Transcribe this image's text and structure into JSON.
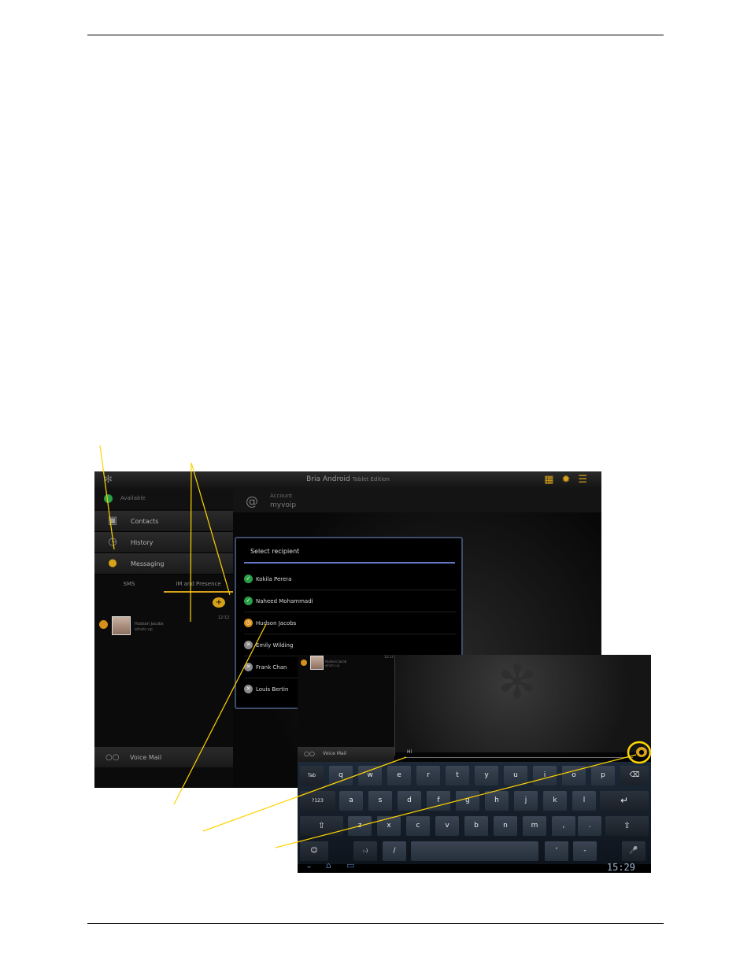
{
  "page": {
    "highlight_color": "#ffd400",
    "line_color": "#000000"
  },
  "screenshot1": {
    "title": "Bria Android",
    "title_edition": "Tablet Edition",
    "top_icons": [
      "dialpad-icon",
      "gear-icon",
      "menu-icon"
    ],
    "status": {
      "label": "Available",
      "color": "#2aa148"
    },
    "nav": {
      "contacts": "Contacts",
      "history": "History",
      "messaging": "Messaging"
    },
    "tabs": {
      "sms": "SMS",
      "im": "IM and Presence"
    },
    "conversation": {
      "name": "Hudson Jacobs",
      "message": "whats up",
      "time": "12:12"
    },
    "voicemail": "Voice Mail",
    "account": {
      "caption": "Account",
      "value": "myvoip"
    },
    "dialog": {
      "title": "Select recipient",
      "recipients": [
        {
          "name": "Kokila Perera",
          "status": "available"
        },
        {
          "name": "Naheed Mohammadi",
          "status": "available"
        },
        {
          "name": "Hudson Jacobs",
          "status": "away"
        },
        {
          "name": "Emily Wilding",
          "status": "offline"
        },
        {
          "name": "Frank Chan",
          "status": "offline"
        },
        {
          "name": "Louis Bertin",
          "status": "offline"
        }
      ]
    }
  },
  "screenshot2": {
    "conversation": {
      "name": "Hudson Jacob",
      "message": "whats up",
      "time": "12:13"
    },
    "voicemail": "Voice Mail",
    "input_value": "Hi",
    "clock": "15:29",
    "keys": {
      "row1": [
        "Tab",
        "q",
        "w",
        "e",
        "r",
        "t",
        "y",
        "u",
        "i",
        "o",
        "p",
        "⌫"
      ],
      "row2": [
        "?123",
        "a",
        "s",
        "d",
        "f",
        "g",
        "h",
        "j",
        "k",
        "l",
        "↵"
      ],
      "row3": [
        "⇧",
        "z",
        "x",
        "c",
        "v",
        "b",
        "n",
        "m",
        ",",
        ".",
        "⇧"
      ],
      "row4": [
        "☺",
        ":-)",
        "/",
        "",
        "'",
        "-",
        "🎤"
      ]
    }
  }
}
